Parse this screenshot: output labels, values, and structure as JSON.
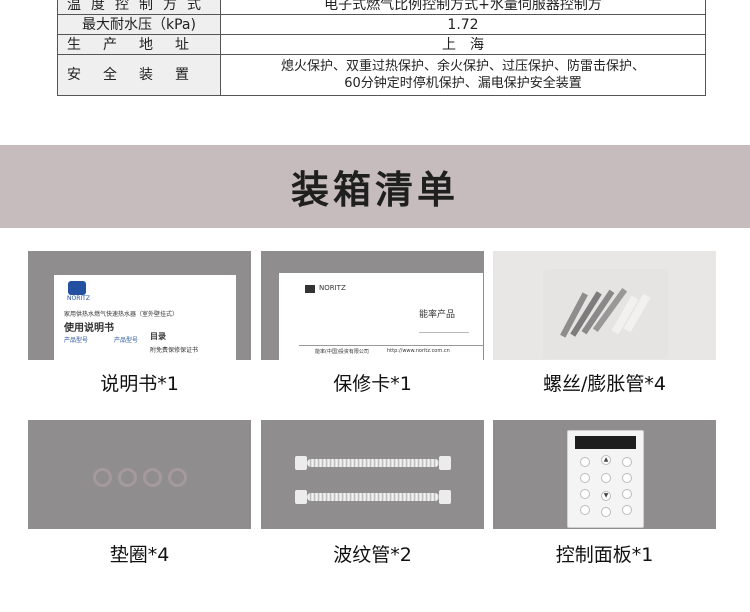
{
  "spec_table": {
    "rows": [
      {
        "label": "温度控制方式",
        "value": "电子式燃气比例控制方式+水量伺服器控制方"
      },
      {
        "label": "最大耐水压（kPa)",
        "value": "1.72"
      },
      {
        "label": "生产地址",
        "value": "上　海"
      },
      {
        "label": "安全装置",
        "value_lines": [
          "熄火保护、双重过热保护、余火保护、过压保护、防雷击保护、",
          "60分钟定时停机保护、漏电保护安全装置"
        ]
      }
    ]
  },
  "section": {
    "title": "装箱清单"
  },
  "items": [
    {
      "caption": "说明书*1"
    },
    {
      "caption": "保修卡*1"
    },
    {
      "caption": "螺丝/膨胀管*4"
    },
    {
      "caption": "垫圈*4"
    },
    {
      "caption": "波纹管*2"
    },
    {
      "caption": "控制面板*1"
    }
  ],
  "manual_doc": {
    "logo": "NORITZ",
    "subtitle": "家用供热水燃气快速热水器（室外壁挂式）",
    "title": "使用说明书",
    "col1": "产品型号",
    "col2": "产品型号",
    "toc": "目录",
    "toc_sub": "附免费保修保证书"
  },
  "warranty_card": {
    "logo": "NORITZ",
    "label": "能率产品",
    "footer": "能率(中国)投资有限公司",
    "url": "http://www.noritz.com.cn"
  }
}
